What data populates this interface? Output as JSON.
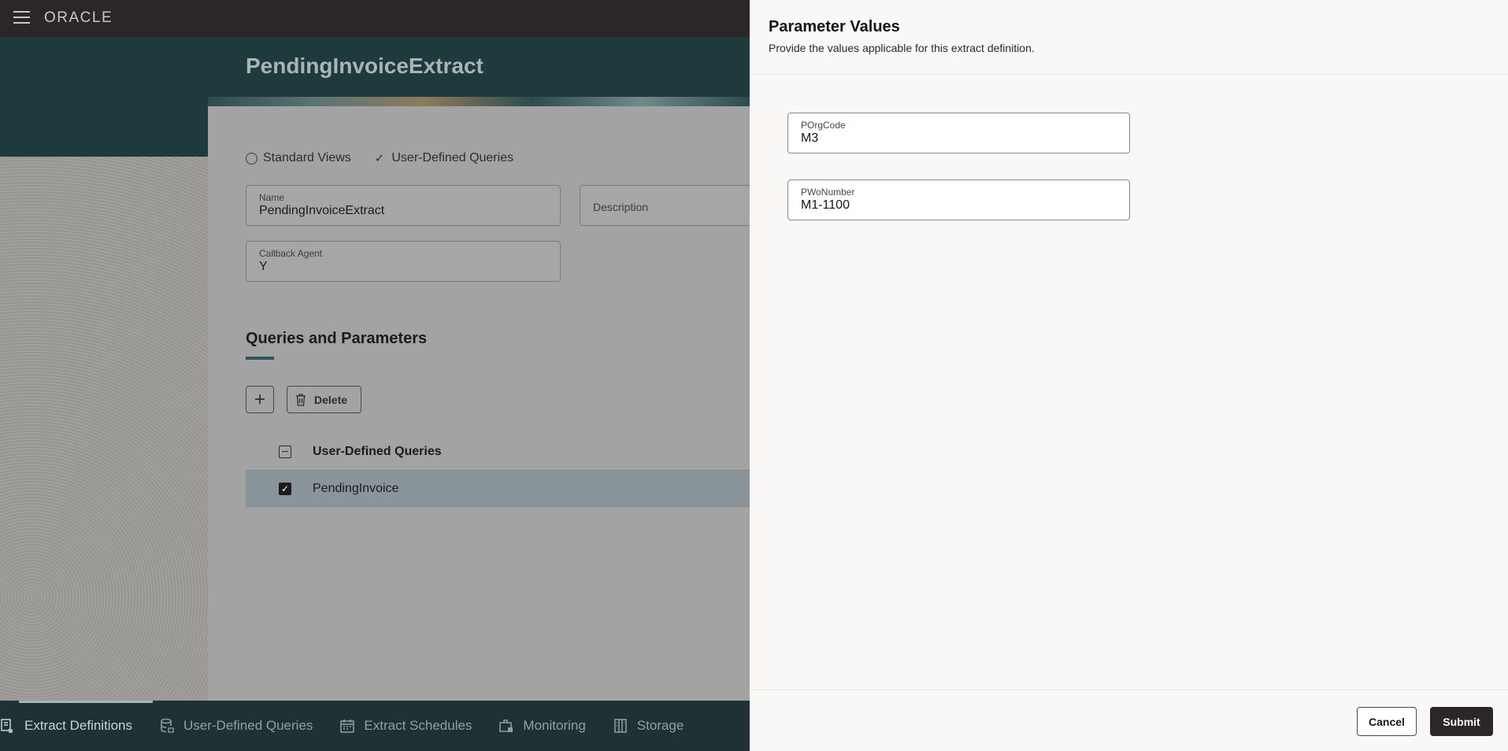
{
  "app": {
    "logo": "ORACLE"
  },
  "page": {
    "title": "PendingInvoiceExtract"
  },
  "views": {
    "standard_label": "Standard Views",
    "user_defined_label": "User-Defined Queries"
  },
  "form": {
    "name_label": "Name",
    "name_value": "PendingInvoiceExtract",
    "description_placeholder": "Description",
    "callback_label": "Callback Agent",
    "callback_value": "Y"
  },
  "queries": {
    "section_title": "Queries and Parameters",
    "add_label": "+",
    "delete_label": "Delete",
    "header": "User-Defined Queries",
    "rows": [
      {
        "label": "PendingInvoice",
        "checked": true
      }
    ]
  },
  "bottom_nav": {
    "items": [
      {
        "label": "Extract Definitions",
        "icon": "extract-definitions-icon",
        "active": true
      },
      {
        "label": "User-Defined Queries",
        "icon": "database-icon",
        "active": false
      },
      {
        "label": "Extract Schedules",
        "icon": "calendar-icon",
        "active": false
      },
      {
        "label": "Monitoring",
        "icon": "monitoring-icon",
        "active": false
      },
      {
        "label": "Storage",
        "icon": "storage-icon",
        "active": false
      }
    ]
  },
  "drawer": {
    "title": "Parameter Values",
    "subtitle": "Provide the values applicable for this extract definition.",
    "params": [
      {
        "label": "POrgCode",
        "value": "M3"
      },
      {
        "label": "PWoNumber",
        "value": "M1-1100"
      }
    ],
    "cancel_label": "Cancel",
    "submit_label": "Submit"
  },
  "colors": {
    "topbar": "#2a2726",
    "banner": "#1f3a3d",
    "bottom_nav": "#1f3134",
    "drawer_bg": "#f9f8f6",
    "submit_bg": "#2a2726"
  }
}
